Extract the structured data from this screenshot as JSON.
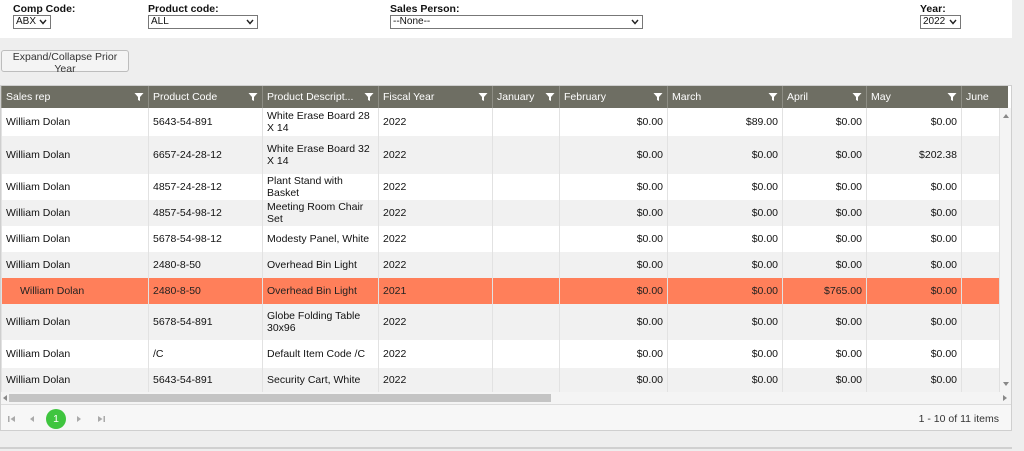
{
  "filters": {
    "comp_code": {
      "label": "Comp Code:",
      "value": "ABX"
    },
    "product_code": {
      "label": "Product code:",
      "value": "ALL"
    },
    "sales_person": {
      "label": "Sales Person:",
      "value": "--None--"
    },
    "year": {
      "label": "Year:",
      "value": "2022"
    }
  },
  "expand_button": "Expand/Collapse Prior Year",
  "grid": {
    "columns": [
      "Sales rep",
      "Product Code",
      "Product Descript...",
      "Fiscal Year",
      "January",
      "February",
      "March",
      "April",
      "May",
      "June"
    ],
    "rows": [
      {
        "rep": "William Dolan",
        "code": "5643-54-891",
        "desc": "White Erase Board 28 X 14",
        "year": "2022",
        "jan": "",
        "feb": "$0.00",
        "mar": "$89.00",
        "apr": "$0.00",
        "may": "$0.00"
      },
      {
        "rep": "William Dolan",
        "code": "6657-24-28-12",
        "desc": "White Erase Board 32 X 14",
        "year": "2022",
        "jan": "",
        "feb": "$0.00",
        "mar": "$0.00",
        "apr": "$0.00",
        "may": "$202.38"
      },
      {
        "rep": "William Dolan",
        "code": "4857-24-28-12",
        "desc": "Plant Stand with Basket",
        "year": "2022",
        "jan": "",
        "feb": "$0.00",
        "mar": "$0.00",
        "apr": "$0.00",
        "may": "$0.00"
      },
      {
        "rep": "William Dolan",
        "code": "4857-54-98-12",
        "desc": "Meeting Room Chair Set",
        "year": "2022",
        "jan": "",
        "feb": "$0.00",
        "mar": "$0.00",
        "apr": "$0.00",
        "may": "$0.00"
      },
      {
        "rep": "William Dolan",
        "code": "5678-54-98-12",
        "desc": "Modesty Panel, White",
        "year": "2022",
        "jan": "",
        "feb": "$0.00",
        "mar": "$0.00",
        "apr": "$0.00",
        "may": "$0.00"
      },
      {
        "rep": "William Dolan",
        "code": "2480-8-50",
        "desc": "Overhead Bin Light",
        "year": "2022",
        "jan": "",
        "feb": "$0.00",
        "mar": "$0.00",
        "apr": "$0.00",
        "may": "$0.00"
      },
      {
        "rep": "William Dolan",
        "code": "2480-8-50",
        "desc": "Overhead Bin Light",
        "year": "2021",
        "jan": "",
        "feb": "$0.00",
        "mar": "$0.00",
        "apr": "$765.00",
        "may": "$0.00"
      },
      {
        "rep": "William Dolan",
        "code": "5678-54-891",
        "desc": "Globe Folding Table 30x96",
        "year": "2022",
        "jan": "",
        "feb": "$0.00",
        "mar": "$0.00",
        "apr": "$0.00",
        "may": "$0.00"
      },
      {
        "rep": "William Dolan",
        "code": "/C",
        "desc": "Default Item Code /C",
        "year": "2022",
        "jan": "",
        "feb": "$0.00",
        "mar": "$0.00",
        "apr": "$0.00",
        "may": "$0.00"
      },
      {
        "rep": "William Dolan",
        "code": "5643-54-891",
        "desc": "Security Cart, White",
        "year": "2022",
        "jan": "",
        "feb": "$0.00",
        "mar": "$0.00",
        "apr": "$0.00",
        "may": "$0.00"
      }
    ]
  },
  "pager": {
    "current_page": "1",
    "info": "1 - 10 of 11 items"
  },
  "colors": {
    "header_bg": "#6e6e63",
    "selected_row": "#ff7f5a",
    "page_active": "#3fc53f"
  }
}
